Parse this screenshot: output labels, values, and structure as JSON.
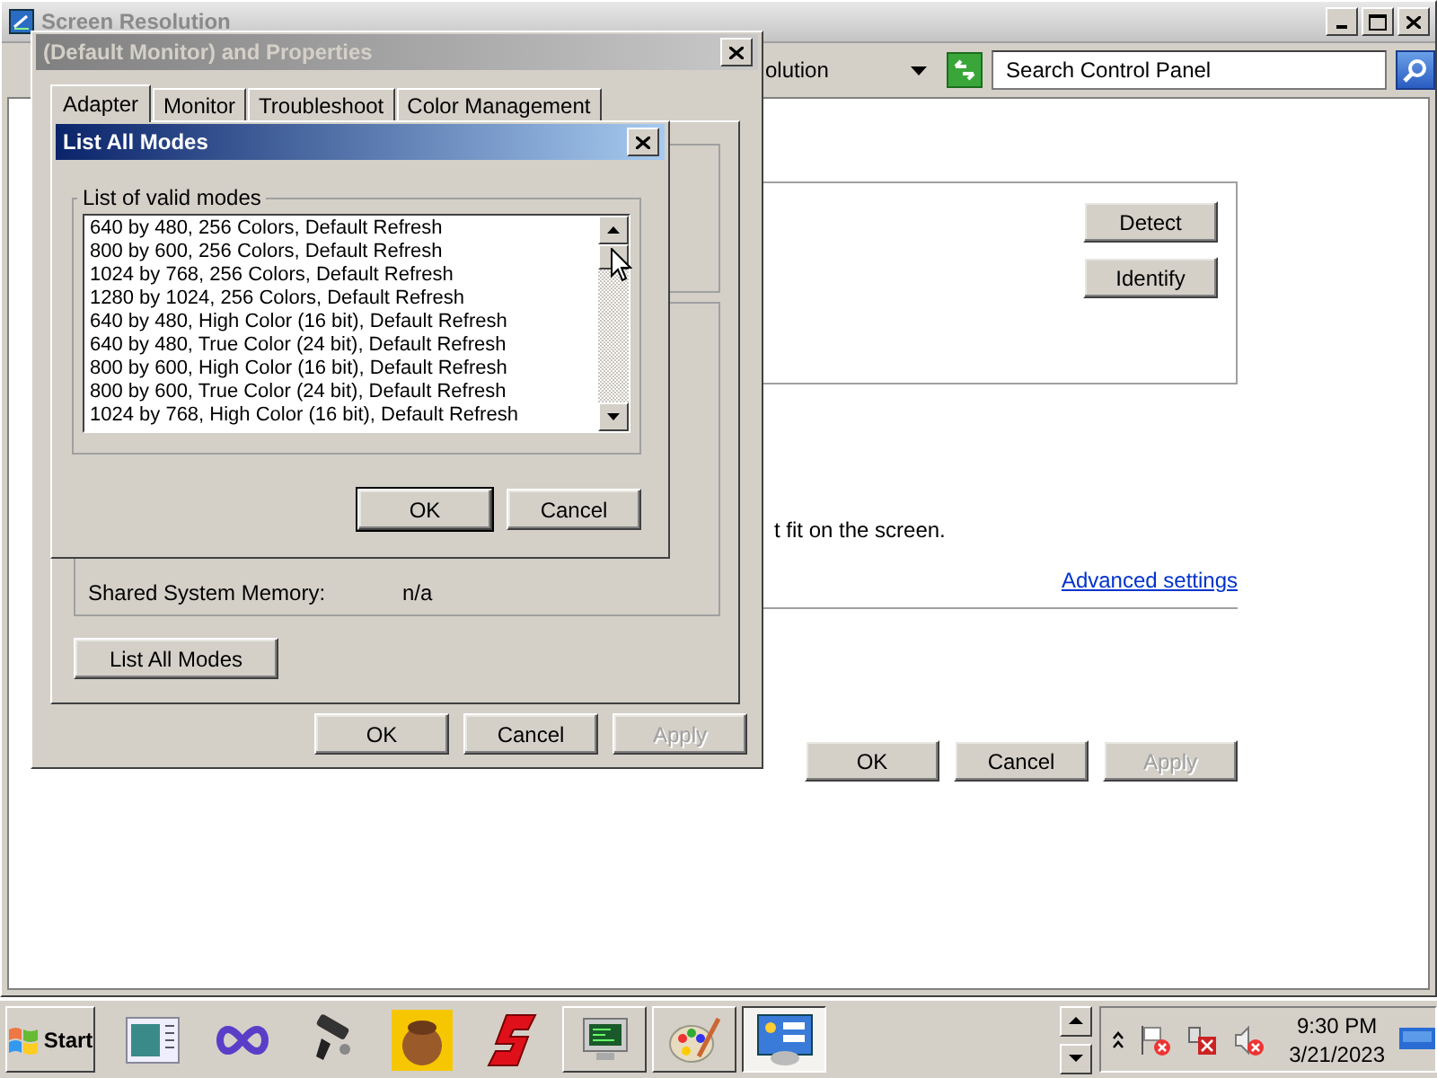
{
  "background_window": {
    "title": "Screen Resolution",
    "address": "olution",
    "search": {
      "placeholder": "Search Control Panel"
    },
    "side_buttons": [
      {
        "label": "Detect"
      },
      {
        "label": "Identify"
      }
    ],
    "hint": "t fit on the screen.",
    "link": "Advanced settings",
    "buttons": [
      {
        "label": "OK",
        "disabled": false
      },
      {
        "label": "Cancel",
        "disabled": false
      },
      {
        "label": "Apply",
        "disabled": true
      }
    ]
  },
  "properties_dialog": {
    "title": "(Default Monitor) and  Properties",
    "active": false,
    "tabs": [
      {
        "label": "Adapter",
        "selected": true
      },
      {
        "label": "Monitor",
        "selected": false
      },
      {
        "label": "Troubleshoot",
        "selected": false
      },
      {
        "label": "Color Management",
        "selected": false
      }
    ],
    "rows": [
      {
        "label": "Shared System Memory:",
        "value": "n/a"
      }
    ],
    "list_button": "List All Modes",
    "buttons": [
      {
        "label": "OK",
        "disabled": false
      },
      {
        "label": "Cancel",
        "disabled": false
      },
      {
        "label": "Apply",
        "disabled": true
      }
    ]
  },
  "modes_dialog": {
    "title": "List All Modes",
    "active": true,
    "group_label": "List of valid modes",
    "modes": [
      "640 by 480, 256 Colors, Default Refresh",
      "800 by 600, 256 Colors, Default Refresh",
      "1024 by 768, 256 Colors, Default Refresh",
      "1280 by 1024, 256 Colors, Default Refresh",
      "640 by 480, High Color (16 bit), Default Refresh",
      "640 by 480, True Color (24 bit), Default Refresh",
      "800 by 600, High Color (16 bit), Default Refresh",
      "800 by 600, True Color (24 bit), Default Refresh",
      "1024 by 768, High Color (16 bit), Default Refresh"
    ],
    "buttons": [
      {
        "label": "OK",
        "default": true
      },
      {
        "label": "Cancel",
        "default": false
      }
    ]
  },
  "taskbar": {
    "start": "Start",
    "apps": [
      {
        "kind": "launcher",
        "selected": false
      },
      {
        "kind": "launcher",
        "selected": false
      },
      {
        "kind": "launcher",
        "selected": false
      },
      {
        "kind": "launcher",
        "selected": false
      },
      {
        "kind": "launcher",
        "selected": false
      },
      {
        "kind": "task",
        "selected": false
      },
      {
        "kind": "task",
        "selected": false
      },
      {
        "kind": "task",
        "selected": true
      }
    ],
    "time": "9:30 PM",
    "date": "3/21/2023"
  }
}
